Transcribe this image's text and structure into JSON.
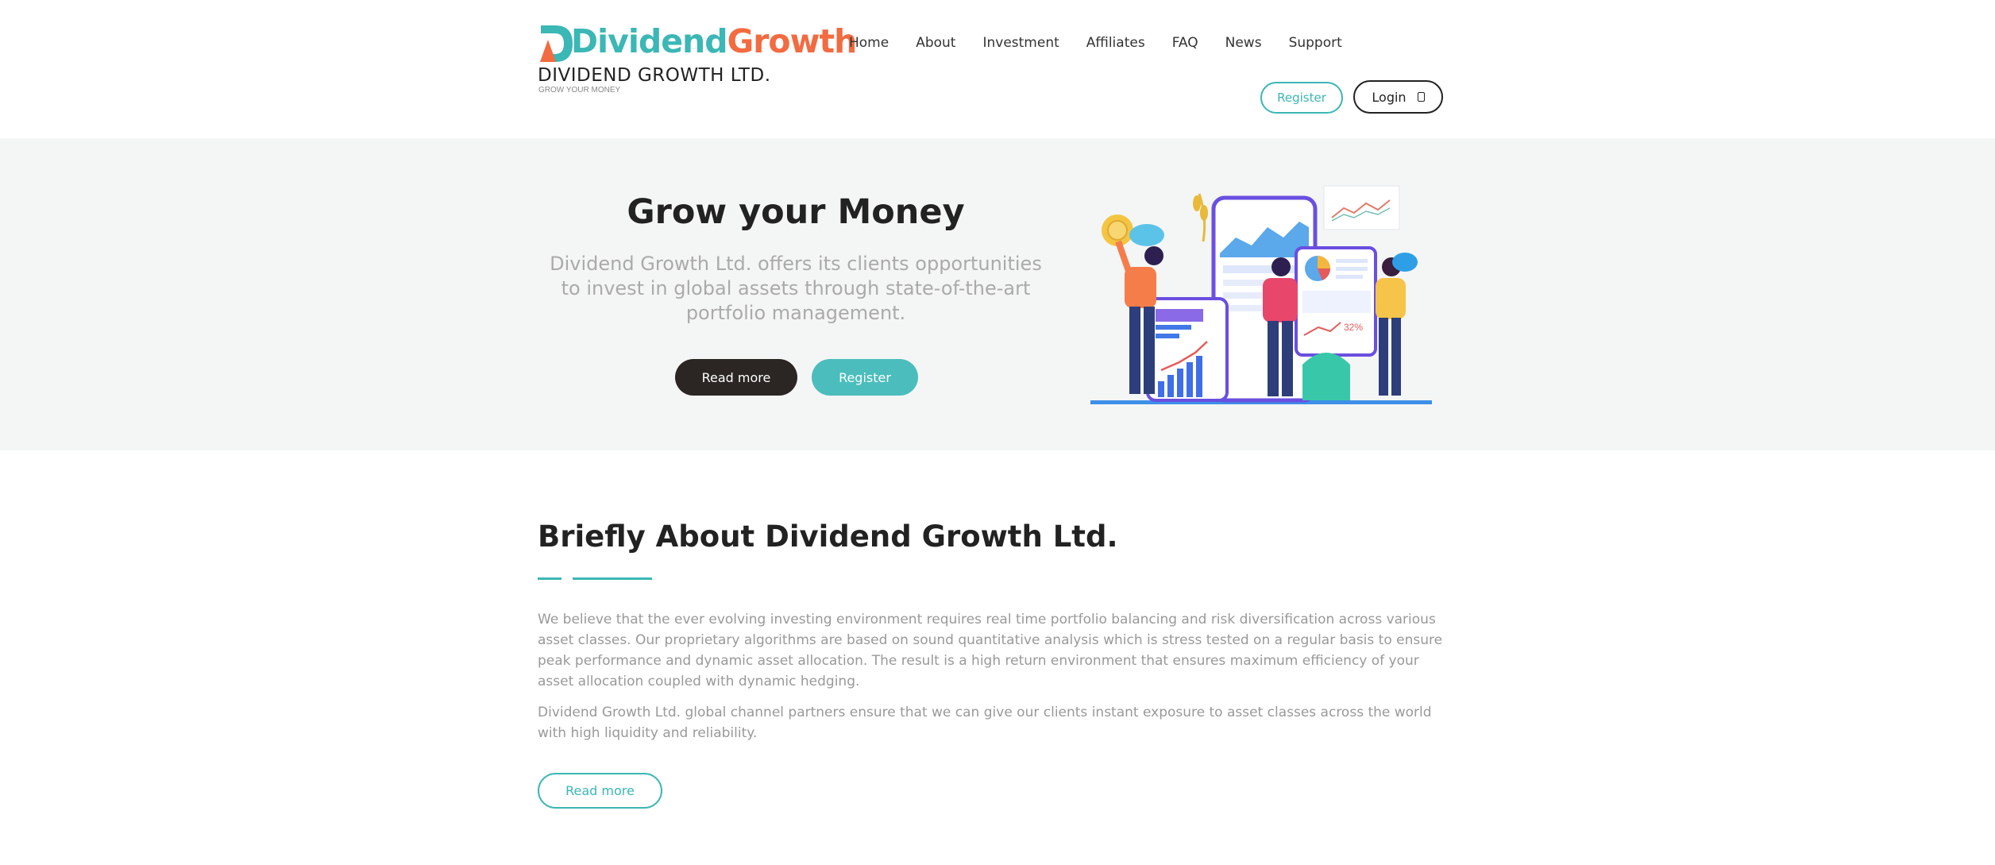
{
  "brand": {
    "logo_word_1": "Dividend",
    "logo_word_2": "Growth",
    "company": "DIVIDEND GROWTH LTD.",
    "tagline": "GROW YOUR MONEY",
    "colors": {
      "teal": "#3bb7b5",
      "orange": "#f26b41"
    }
  },
  "nav": {
    "items": [
      {
        "label": "Home"
      },
      {
        "label": "About"
      },
      {
        "label": "Investment"
      },
      {
        "label": "Affiliates"
      },
      {
        "label": "FAQ"
      },
      {
        "label": "News"
      },
      {
        "label": "Support"
      }
    ],
    "register_label": "Register",
    "login_label": "Login"
  },
  "hero": {
    "title": "Grow your Money",
    "description": "Dividend Growth Ltd. offers its clients opportunities to invest in global assets through state-of-the-art portfolio management.",
    "read_more_label": "Read more",
    "register_label": "Register",
    "illustration_badge": "32%"
  },
  "about": {
    "title": "Briefly About Dividend Growth Ltd.",
    "paragraph_1": "We believe that the ever evolving investing environment requires real time portfolio balancing and risk diversification across various asset classes. Our proprietary algorithms are based on sound quantitative analysis which is stress tested on a regular basis to ensure peak performance and dynamic asset allocation. The result is a high return environment that ensures maximum efficiency of your asset allocation coupled with dynamic hedging.",
    "paragraph_2": "Dividend Growth Ltd. global channel partners ensure that we can give our clients instant exposure to asset classes across the world with high liquidity and reliability.",
    "read_more_label": "Read more"
  }
}
